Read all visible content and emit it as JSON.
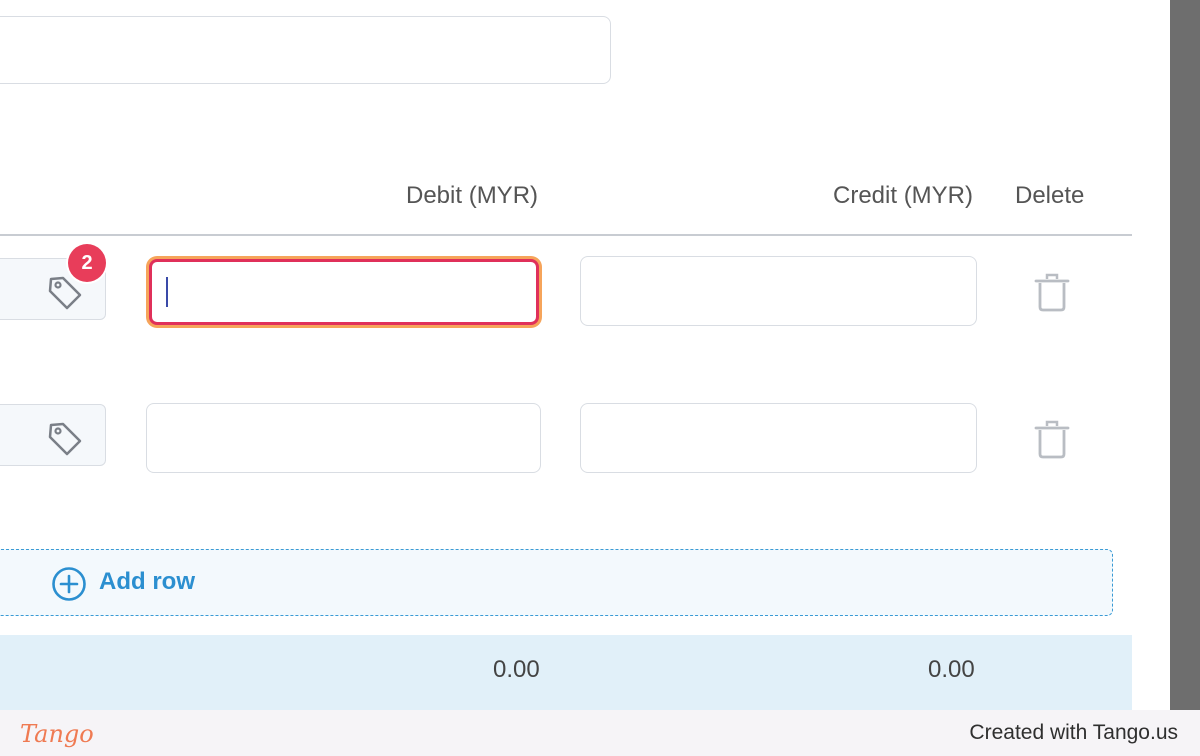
{
  "columns": {
    "debit": "Debit (MYR)",
    "credit": "Credit (MYR)",
    "delete": "Delete"
  },
  "rows": [
    {
      "tag_badge": "2",
      "debit_value": "",
      "credit_value": "",
      "debit_focused": true
    },
    {
      "tag_badge": "",
      "debit_value": "",
      "credit_value": "",
      "debit_focused": false
    }
  ],
  "add_row": {
    "label": "Add row"
  },
  "totals": {
    "debit": "0.00",
    "credit": "0.00"
  },
  "footer": {
    "logo": "Tango",
    "credit": "Created with Tango.us"
  },
  "colors": {
    "accent": "#2b8fd0",
    "badge": "#e83d5a",
    "focus_border": "#e0305a",
    "focus_glow": "#f6a45a",
    "totals_bg": "#e1f0f9",
    "tango_orange": "#ef7a52"
  },
  "icons": {
    "tag": "tag-icon",
    "delete": "trash-icon",
    "add": "plus-circle-icon"
  }
}
